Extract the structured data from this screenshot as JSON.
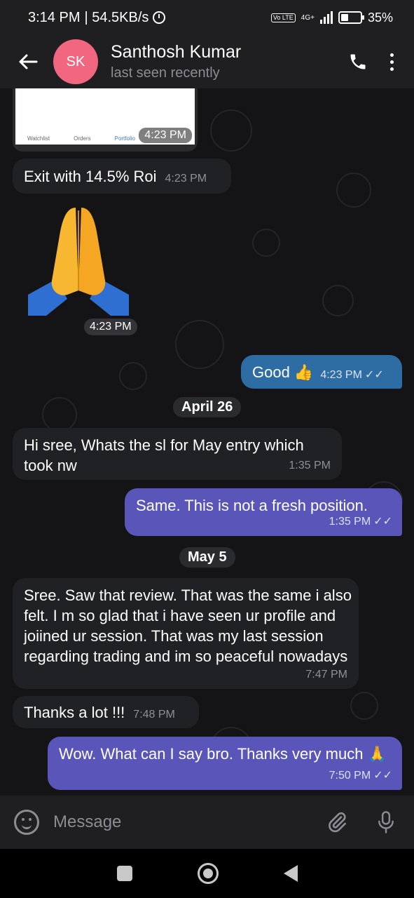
{
  "status_bar": {
    "time": "3:14 PM",
    "net_speed": "| 54.5KB/s",
    "volte": "Vo LTE",
    "network": "4G+",
    "battery": "35%"
  },
  "header": {
    "avatar_initials": "SK",
    "name": "Santhosh Kumar",
    "status": "last seen recently",
    "avatar_color": "#f0677f"
  },
  "messages": {
    "screenshot_card": {
      "nav_labels": [
        "Watchlist",
        "Orders",
        "Portfolio",
        "",
        ""
      ],
      "time": "4:23 PM"
    },
    "m1": {
      "text": "Exit with 14.5% Roi",
      "time": "4:23 PM"
    },
    "m2": {
      "emoji": "🙏",
      "time": "4:23 PM"
    },
    "m3": {
      "text": "Good 👍",
      "time": "4:23 PM",
      "ticks": "✓✓"
    },
    "date1": "April 26",
    "m4": {
      "text": "Hi sree, Whats the sl for May entry which took nw",
      "time": "1:35 PM"
    },
    "m5": {
      "text": "Same. This is not a fresh position.",
      "time": "1:35 PM",
      "ticks": "✓✓"
    },
    "date2": "May 5",
    "m6": {
      "text": "Sree. Saw that review. That was the same i also felt. I m so glad that i have seen ur profile and joiined ur session. That was my last session regarding trading and im so peaceful nowadays",
      "time": "7:47 PM"
    },
    "m7": {
      "text": "Thanks a lot !!!",
      "time": "7:48 PM"
    },
    "m8": {
      "text": "Wow. What can I say bro. Thanks very much 🙏",
      "time": "7:50 PM",
      "ticks": "✓✓"
    }
  },
  "composer": {
    "placeholder": "Message"
  },
  "icons": {
    "back": "arrow-left-icon",
    "call": "phone-icon",
    "menu": "more-vertical-icon",
    "emoji": "smile-icon",
    "attach": "paperclip-icon",
    "mic": "microphone-icon"
  },
  "colors": {
    "incoming_bubble": "#202124",
    "outgoing_blue": "#2e6da4",
    "outgoing_purple": "#5a55b8"
  }
}
